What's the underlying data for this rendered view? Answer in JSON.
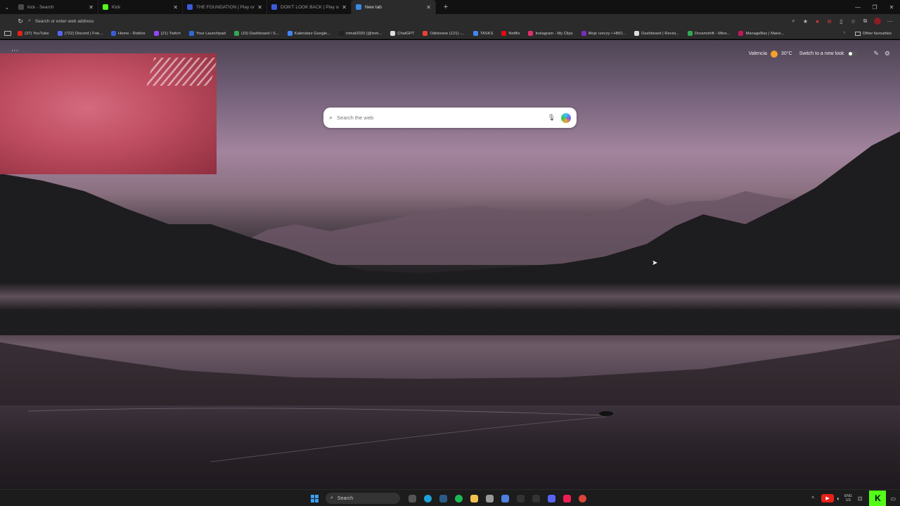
{
  "tabs": [
    {
      "title": "kick - Search",
      "favicon_color": "#4a4a4a",
      "active": false
    },
    {
      "title": "Kick",
      "favicon_color": "#53fc18",
      "active": false
    },
    {
      "title": "THE FOUNDATION | Play on Robl",
      "favicon_color": "#3b5bdb",
      "active": false
    },
    {
      "title": "DON'T LOOK BACK | Play on Robl",
      "favicon_color": "#3b5bdb",
      "active": false
    },
    {
      "title": "New tab",
      "favicon_color": "#3a88e8",
      "active": true
    }
  ],
  "address": {
    "placeholder": "Search or enter web address"
  },
  "bookmarks": [
    {
      "label": "(37) YouTube",
      "color": "#e62117"
    },
    {
      "label": "(722) Discord | Frie...",
      "color": "#5865f2"
    },
    {
      "label": "Home - Roblox",
      "color": "#3b5bdb"
    },
    {
      "label": "(21) Twitch",
      "color": "#9146ff"
    },
    {
      "label": "Your Launchpad",
      "color": "#2f6bd8"
    },
    {
      "label": "(10) Dashboard / S...",
      "color": "#33a853"
    },
    {
      "label": "Kalendarz Google...",
      "color": "#4285f4"
    },
    {
      "label": "mmat2020 (@mm...",
      "color": "#222222"
    },
    {
      "label": "ChatGPT",
      "color": "#dddddd"
    },
    {
      "label": "Odebrane (121) -...",
      "color": "#ea4335"
    },
    {
      "label": "TASKS",
      "color": "#4285f4"
    },
    {
      "label": "Netflix",
      "color": "#e50914"
    },
    {
      "label": "Instagram - My Clips",
      "color": "#e1306c"
    },
    {
      "label": "Moje rzeczy • HBO...",
      "color": "#7b2cbf"
    },
    {
      "label": "Dashboard | Revisi...",
      "color": "#dddddd"
    },
    {
      "label": "Dreamshift - Mine...",
      "color": "#33a853"
    },
    {
      "label": "ManageBac | Mane...",
      "color": "#c2185b"
    }
  ],
  "bookmarks_other": "Other favourites",
  "newtab": {
    "weather_city": "Valencia",
    "weather_temp": "30°C",
    "new_look_label": "Switch to a new look",
    "search_placeholder": "Search the web"
  },
  "taskbar": {
    "search_label": "Search",
    "lang_top": "ENG",
    "lang_bottom": "US"
  },
  "colors": {
    "accent": "#3a88e8",
    "kick": "#53fc18"
  }
}
